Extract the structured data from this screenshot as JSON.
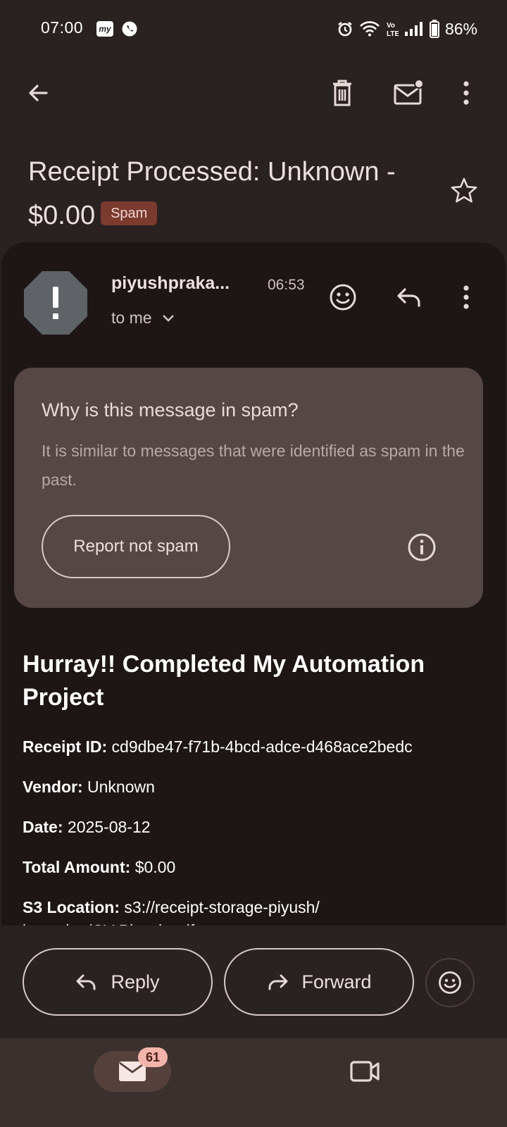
{
  "status_bar": {
    "time": "07:00",
    "app_badge": "my",
    "battery": "86%",
    "icons": [
      "alarm-icon",
      "wifi-icon",
      "volte-icon",
      "signal-icon",
      "battery-icon"
    ]
  },
  "toolbar": {
    "icons": [
      "back-arrow-icon",
      "delete-icon",
      "mark-unread-icon",
      "more-vert-icon"
    ]
  },
  "email": {
    "subject": "Receipt Processed: Unknown - $0.00",
    "label_chip": "Spam",
    "sender": "piyushpraka...",
    "sent_time": "06:53",
    "recipient": "to me"
  },
  "spam_notice": {
    "title": "Why is this message in spam?",
    "description": "It is similar to messages that were identified as spam in the past.",
    "report_button": "Report not spam"
  },
  "body": {
    "heading": "Hurray!! Completed My Automation Project",
    "fields": [
      {
        "label": "Receipt ID:",
        "value": "cd9dbe47-f71b-4bcd-adce-d468ace2bedc"
      },
      {
        "label": "Vendor:",
        "value": "Unknown"
      },
      {
        "label": "Date:",
        "value": "2025-08-12"
      },
      {
        "label": "Total Amount:",
        "value": "$0.00"
      },
      {
        "label": "S3 Location:",
        "value": "s3://receipt-storage-piyush/"
      }
    ],
    "partial_line": "incoming/CV-Piyush.pdf"
  },
  "actions": {
    "reply": "Reply",
    "forward": "Forward"
  },
  "bottom_nav": {
    "mail_unread_count": "61"
  },
  "colors": {
    "background": "#2a2221",
    "card": "#1d1615",
    "spam_box": "#544745",
    "spam_chip": "#7a3a2e",
    "badge": "#f3b4ab"
  }
}
